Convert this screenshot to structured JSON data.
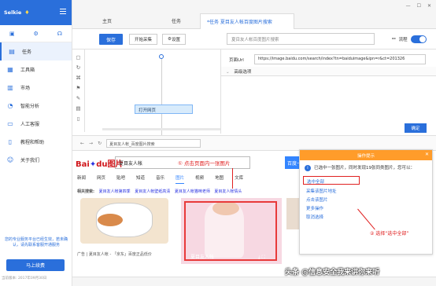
{
  "app": {
    "logo": "Selkie",
    "version": "当前版本: 2017年09月30日"
  },
  "sidebar": {
    "items": [
      {
        "label": "任务",
        "icon": "task-icon"
      },
      {
        "label": "工具箱",
        "icon": "toolbox-icon"
      },
      {
        "label": "市场",
        "icon": "market-icon"
      },
      {
        "label": "智能分析",
        "icon": "analysis-icon"
      },
      {
        "label": "人工客服",
        "icon": "service-icon"
      },
      {
        "label": "教程和帮助",
        "icon": "help-icon"
      },
      {
        "label": "关于我们",
        "icon": "about-icon"
      }
    ],
    "promo_text": "您的专业服务平台已经生效，若未确认，请先联系客服开通服务",
    "promo_button": "马上续费"
  },
  "tabs": [
    {
      "label": "主页"
    },
    {
      "label": "任务"
    },
    {
      "label": "*任务 夏目友人帐百度图片搜索"
    }
  ],
  "toolbar": {
    "save": "保存",
    "generate": "开始采集",
    "settings": "设置",
    "task_name": "夏目友人帐百度图片搜索",
    "flow_label": "流程"
  },
  "canvas": {
    "node_label": "打开网页"
  },
  "props": {
    "url_label": "页面Url",
    "url_value": "https://image.baidu.com/search/index?tn=baiduimage&ipn=r&ct=201326",
    "advanced": "高级选项",
    "confirm": "确定"
  },
  "browser": {
    "address": "夏目友人帐_百度图片搜索"
  },
  "baidu": {
    "logo_a": "Bai",
    "logo_b": "du",
    "logo_c": "图片",
    "query": "夏目友人帐",
    "search_btn": "百度一下",
    "note1": "① 点击页面内一张图片",
    "tabs": [
      "新闻",
      "网页",
      "贴吧",
      "知道",
      "音乐",
      "图片",
      "视频",
      "地图",
      "文库"
    ],
    "related_label": "相关搜索:",
    "related": [
      "夏目友人帐第四季",
      "夏目友人帐壁纸高清",
      "夏目友人帐猫咪老师",
      "夏目友人帐情头"
    ],
    "ad_text": "广告 | 夏目友人帐 - 「京东」百度正品低价",
    "image_caption": "夏目友人帐"
  },
  "tips": {
    "title": "操作提示",
    "message": "已选中一张图片，同时发现19张同类图片，您可以：",
    "options": [
      "选中全部",
      "采集该图片地址",
      "点击该图片",
      "更多操作",
      "取消选择"
    ],
    "step_note": "② 选择“选中全部”"
  },
  "watermark": "头条 @信息安全我来讲你来听"
}
